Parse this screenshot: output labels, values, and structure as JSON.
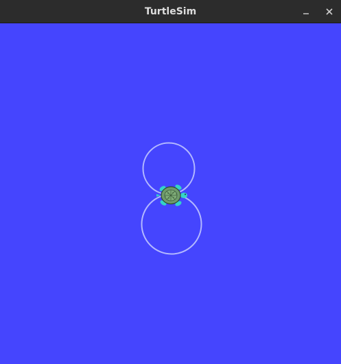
{
  "window": {
    "title": "TurtleSim"
  },
  "titlebar_buttons": {
    "minimize": "minimize-icon",
    "close": "close-icon"
  },
  "canvas": {
    "background_color": "#4545fe",
    "trail_color": "#b3b8ff"
  }
}
